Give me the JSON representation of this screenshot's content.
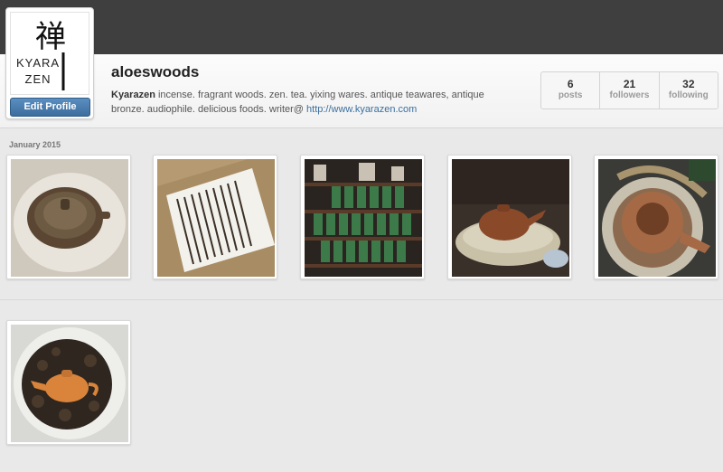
{
  "profile": {
    "username": "aloeswoods",
    "display_name": "Kyarazen",
    "bio_text": " incense. fragrant woods. zen. tea. yixing wares. antique teawares, antique bronze. audiophile. delicious foods. writer@ ",
    "website": "http://www.kyarazen.com",
    "edit_label": "Edit Profile",
    "avatar_logo": {
      "glyph": "禅",
      "line1": "KYARA",
      "line2": "ZEN"
    }
  },
  "stats": [
    {
      "value": "6",
      "label": "posts"
    },
    {
      "value": "21",
      "label": "followers"
    },
    {
      "value": "32",
      "label": "following"
    }
  ],
  "feed": {
    "section_label": "January 2015",
    "photos": [
      {
        "subject": "antique teapot lid on white cloth"
      },
      {
        "subject": "incense sticks in box"
      },
      {
        "subject": "shelves of green tea tins"
      },
      {
        "subject": "yixing teapot in bowl"
      },
      {
        "subject": "clay teapot on burner"
      },
      {
        "subject": "small teapot on dried tea leaves"
      }
    ]
  },
  "colors": {
    "topbar": "#3f3f3f",
    "accent_button": "#3c6d9d",
    "link": "#3a6f9f",
    "background": "#e9e9e9"
  }
}
